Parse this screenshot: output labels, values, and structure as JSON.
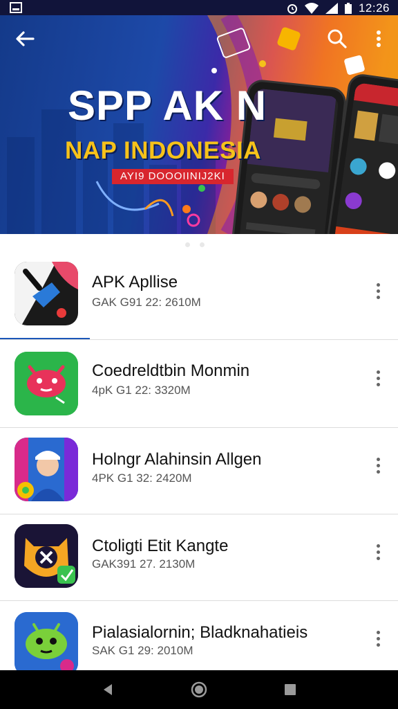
{
  "status_bar": {
    "time": "12:26",
    "icons": [
      "notification-icon",
      "alarm-icon",
      "wifi-icon",
      "signal-icon",
      "battery-icon"
    ]
  },
  "banner": {
    "title": "SPP AK N",
    "subtitle": "NAP INDONESIA",
    "ribbon": "AYI9 DOOOIINIJ2KI",
    "colors": {
      "left": "#1d49a8",
      "mid": "#c0178d",
      "right": "#f5a017",
      "subtitle": "#f6c21a"
    }
  },
  "apps": [
    {
      "name": "APK Apllise",
      "meta": "GAK G91 22: 2610M"
    },
    {
      "name": "Coedreldtbin Monmin",
      "meta": "4pK G1 22: 3320M"
    },
    {
      "name": "Holngr Alahinsin Allgen",
      "meta": "4PK G1 32: 2420M"
    },
    {
      "name": "Ctoligti Etit Kangte",
      "meta": "GAK391 27. 2130M"
    },
    {
      "name": "Pialasialornin; Bladknahatieis",
      "meta": "SAK G1 29: 2010M"
    }
  ],
  "accent_color": "#1a56b8"
}
